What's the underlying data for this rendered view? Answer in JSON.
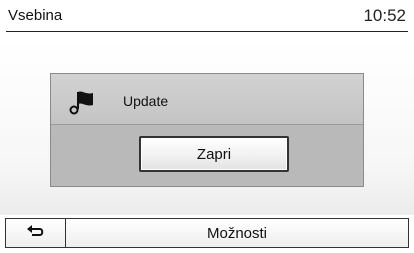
{
  "header": {
    "title": "Vsebina",
    "time": "10:52"
  },
  "dialog": {
    "message": "Update",
    "icon": "flag-icon",
    "close_label": "Zapri"
  },
  "bottom_bar": {
    "back_icon": "back-arrow-icon",
    "options_label": "Možnosti"
  }
}
